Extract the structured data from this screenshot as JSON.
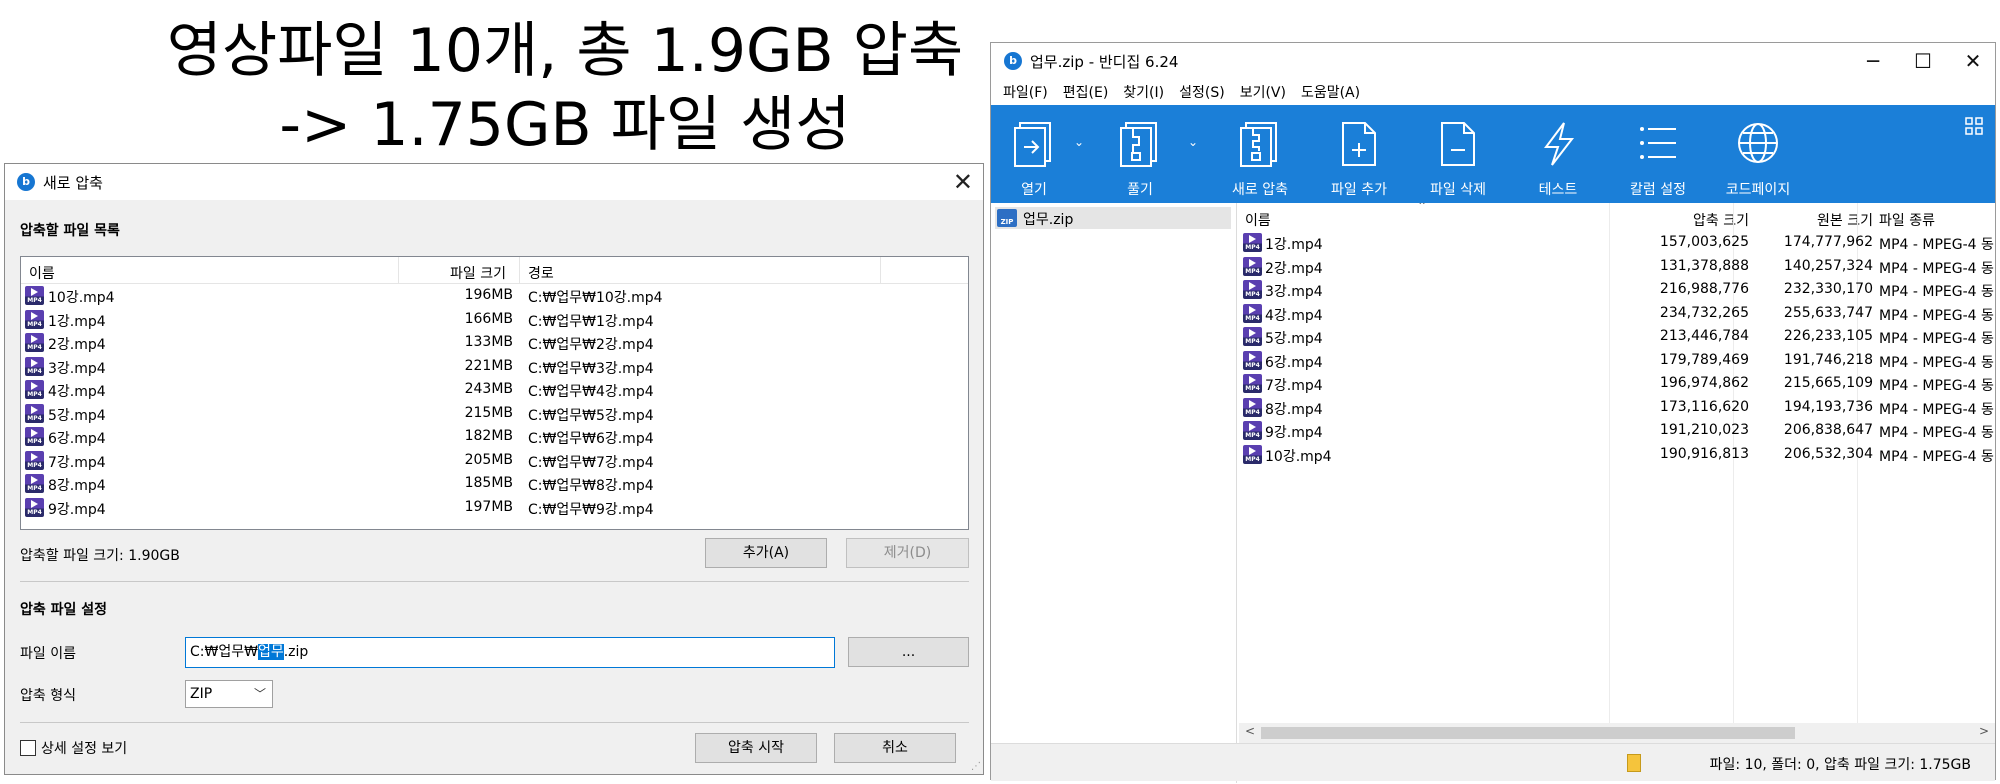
{
  "caption": {
    "line1": "영상파일 10개, 총 1.9GB 압축",
    "line2": "-> 1.75GB 파일 생성"
  },
  "dialog": {
    "title": "새로 압축",
    "close_icon": "close-icon",
    "list_section": "압축할 파일 목록",
    "columns": {
      "name": "이름",
      "size": "파일 크기",
      "path": "경로"
    },
    "files": [
      {
        "name": "10강.mp4",
        "size": "196MB",
        "path": "C:₩업무₩10강.mp4"
      },
      {
        "name": "1강.mp4",
        "size": "166MB",
        "path": "C:₩업무₩1강.mp4"
      },
      {
        "name": "2강.mp4",
        "size": "133MB",
        "path": "C:₩업무₩2강.mp4"
      },
      {
        "name": "3강.mp4",
        "size": "221MB",
        "path": "C:₩업무₩3강.mp4"
      },
      {
        "name": "4강.mp4",
        "size": "243MB",
        "path": "C:₩업무₩4강.mp4"
      },
      {
        "name": "5강.mp4",
        "size": "215MB",
        "path": "C:₩업무₩5강.mp4"
      },
      {
        "name": "6강.mp4",
        "size": "182MB",
        "path": "C:₩업무₩6강.mp4"
      },
      {
        "name": "7강.mp4",
        "size": "205MB",
        "path": "C:₩업무₩7강.mp4"
      },
      {
        "name": "8강.mp4",
        "size": "185MB",
        "path": "C:₩업무₩8강.mp4"
      },
      {
        "name": "9강.mp4",
        "size": "197MB",
        "path": "C:₩업무₩9강.mp4"
      }
    ],
    "total_size": "압축할 파일 크기: 1.90GB",
    "add_button": "추가(A)",
    "remove_button": "제거(D)",
    "settings_section": "압축 파일 설정",
    "filename_label": "파일 이름",
    "filename_prefix": "C:₩업무₩",
    "filename_selected": "업무",
    "filename_suffix": ".zip",
    "browse_button": "...",
    "format_label": "압축 형식",
    "format_value": "ZIP",
    "advanced_label": "상세 설정 보기",
    "start_button": "압축 시작",
    "cancel_button": "취소"
  },
  "window": {
    "title": "업무.zip - 반디집 6.24",
    "menu": [
      "파일(F)",
      "편집(E)",
      "찾기(I)",
      "설정(S)",
      "보기(V)",
      "도움말(A)"
    ],
    "toolbar": {
      "open": "열기",
      "extract": "풀기",
      "new_archive": "새로 압축",
      "add_file": "파일 추가",
      "delete_file": "파일 삭제",
      "test": "테스트",
      "columns": "칼럼 설정",
      "codepage": "코드페이지"
    },
    "tree_item": "업무.zip",
    "columns": {
      "name": "이름",
      "compressed": "압축 크기",
      "original": "원본 크기",
      "type": "파일 종류"
    },
    "files": [
      {
        "name": "1강.mp4",
        "compressed": "157,003,625",
        "original": "174,777,962",
        "type": "MP4 - MPEG-4 동"
      },
      {
        "name": "2강.mp4",
        "compressed": "131,378,888",
        "original": "140,257,324",
        "type": "MP4 - MPEG-4 동"
      },
      {
        "name": "3강.mp4",
        "compressed": "216,988,776",
        "original": "232,330,170",
        "type": "MP4 - MPEG-4 동"
      },
      {
        "name": "4강.mp4",
        "compressed": "234,732,265",
        "original": "255,633,747",
        "type": "MP4 - MPEG-4 동"
      },
      {
        "name": "5강.mp4",
        "compressed": "213,446,784",
        "original": "226,233,105",
        "type": "MP4 - MPEG-4 동"
      },
      {
        "name": "6강.mp4",
        "compressed": "179,789,469",
        "original": "191,746,218",
        "type": "MP4 - MPEG-4 동"
      },
      {
        "name": "7강.mp4",
        "compressed": "196,974,862",
        "original": "215,665,109",
        "type": "MP4 - MPEG-4 동"
      },
      {
        "name": "8강.mp4",
        "compressed": "173,116,620",
        "original": "194,193,736",
        "type": "MP4 - MPEG-4 동"
      },
      {
        "name": "9강.mp4",
        "compressed": "191,210,023",
        "original": "206,838,647",
        "type": "MP4 - MPEG-4 동"
      },
      {
        "name": "10강.mp4",
        "compressed": "190,916,813",
        "original": "206,532,304",
        "type": "MP4 - MPEG-4 동"
      }
    ],
    "status": "파일: 10, 폴더: 0, 압축 파일 크기: 1.75GB"
  },
  "colors": {
    "toolbar": "#1b7fd8",
    "selection": "#0078d7",
    "icon_mp4": "#5a3fb0"
  }
}
